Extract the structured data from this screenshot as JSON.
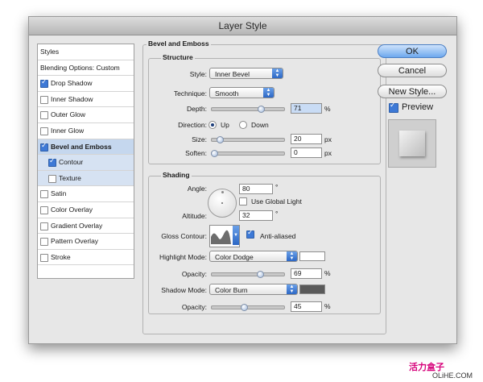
{
  "window": {
    "title": "Layer Style"
  },
  "styles_list": [
    {
      "label": "Styles",
      "checkbox": false,
      "checked": false,
      "selected": false,
      "indent": false
    },
    {
      "label": "Blending Options: Custom",
      "checkbox": false,
      "checked": false,
      "selected": false,
      "indent": false
    },
    {
      "label": "Drop Shadow",
      "checkbox": true,
      "checked": true,
      "selected": false,
      "indent": false
    },
    {
      "label": "Inner Shadow",
      "checkbox": true,
      "checked": false,
      "selected": false,
      "indent": false
    },
    {
      "label": "Outer Glow",
      "checkbox": true,
      "checked": false,
      "selected": false,
      "indent": false
    },
    {
      "label": "Inner Glow",
      "checkbox": true,
      "checked": false,
      "selected": false,
      "indent": false
    },
    {
      "label": "Bevel and Emboss",
      "checkbox": true,
      "checked": true,
      "selected": true,
      "indent": false
    },
    {
      "label": "Contour",
      "checkbox": true,
      "checked": true,
      "selected": true,
      "indent": true
    },
    {
      "label": "Texture",
      "checkbox": true,
      "checked": false,
      "selected": true,
      "indent": true
    },
    {
      "label": "Satin",
      "checkbox": true,
      "checked": false,
      "selected": false,
      "indent": false
    },
    {
      "label": "Color Overlay",
      "checkbox": true,
      "checked": false,
      "selected": false,
      "indent": false
    },
    {
      "label": "Gradient Overlay",
      "checkbox": true,
      "checked": false,
      "selected": false,
      "indent": false
    },
    {
      "label": "Pattern Overlay",
      "checkbox": true,
      "checked": false,
      "selected": false,
      "indent": false
    },
    {
      "label": "Stroke",
      "checkbox": true,
      "checked": false,
      "selected": false,
      "indent": false
    }
  ],
  "bevel": {
    "section_title": "Bevel and Emboss",
    "structure_title": "Structure",
    "style_label": "Style:",
    "style_value": "Inner Bevel",
    "technique_label": "Technique:",
    "technique_value": "Smooth",
    "depth_label": "Depth:",
    "depth_value": "71",
    "depth_unit": "%",
    "depth_fraction": 0.71,
    "direction_label": "Direction:",
    "direction_up": "Up",
    "direction_down": "Down",
    "size_label": "Size:",
    "size_value": "20",
    "size_unit": "px",
    "size_fraction": 0.08,
    "soften_label": "Soften:",
    "soften_value": "0",
    "soften_unit": "px",
    "soften_fraction": 0.0
  },
  "shading": {
    "title": "Shading",
    "angle_label": "Angle:",
    "angle_value": "80",
    "degree": "°",
    "use_global_light": "Use Global Light",
    "altitude_label": "Altitude:",
    "altitude_value": "32",
    "gloss_contour_label": "Gloss Contour:",
    "anti_aliased": "Anti-aliased",
    "highlight_mode_label": "Highlight Mode:",
    "highlight_mode_value": "Color Dodge",
    "highlight_color": "#ffffff",
    "highlight_opacity_label": "Opacity:",
    "highlight_opacity_value": "69",
    "highlight_opacity_fraction": 0.69,
    "shadow_mode_label": "Shadow Mode:",
    "shadow_mode_value": "Color Burn",
    "shadow_color": "#5a5a5a",
    "shadow_opacity_label": "Opacity:",
    "shadow_opacity_value": "45",
    "shadow_opacity_fraction": 0.45,
    "percent": "%"
  },
  "buttons": {
    "ok": "OK",
    "cancel": "Cancel",
    "new_style": "New Style...",
    "preview": "Preview"
  },
  "watermark": {
    "line1": "活力盒子",
    "line2": "OLiHE.COM"
  }
}
